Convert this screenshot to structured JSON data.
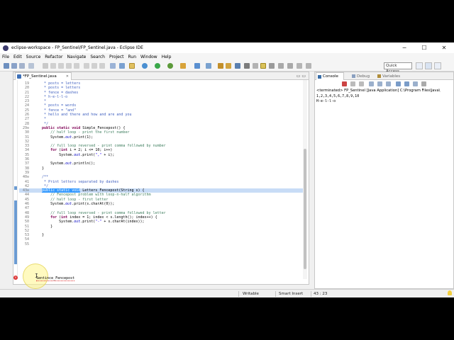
{
  "window": {
    "title": "eclipse-workspace - FP_Sentinel/FP_Sentinel.java - Eclipse IDE",
    "minimize": "─",
    "maximize": "☐",
    "close": "✕"
  },
  "menu": [
    "File",
    "Edit",
    "Source",
    "Refactor",
    "Navigate",
    "Search",
    "Project",
    "Run",
    "Window",
    "Help"
  ],
  "toolbar": {
    "quick_access": "Quick Access"
  },
  "editor": {
    "tab_label": "*FP_Sentinel.java",
    "tab_close": "✕",
    "min_max": "▭ ▭"
  },
  "console": {
    "tabs": [
      "Console",
      "Debug",
      "Variables"
    ],
    "terminated": "<terminated> FP_Sentinel [Java Application] C:\\Program Files\\Java\\",
    "output": [
      "1,2,3,4,5,6,7,8,9,10",
      "H-e-l-l-o"
    ]
  },
  "status": {
    "writable": "Writable",
    "insert_mode": "Smart Insert",
    "position": "43 : 23"
  },
  "icons": {
    "error": "×",
    "cursor": "I"
  },
  "overlay_text": "Sentince_Fencepost",
  "colors": {
    "keyword": "#7f0055",
    "comment": "#3f7f5f",
    "javadoc": "#3f5fbf",
    "string": "#2a00ff",
    "selection": "#3399ff",
    "current_line": "#c8dcf6"
  }
}
